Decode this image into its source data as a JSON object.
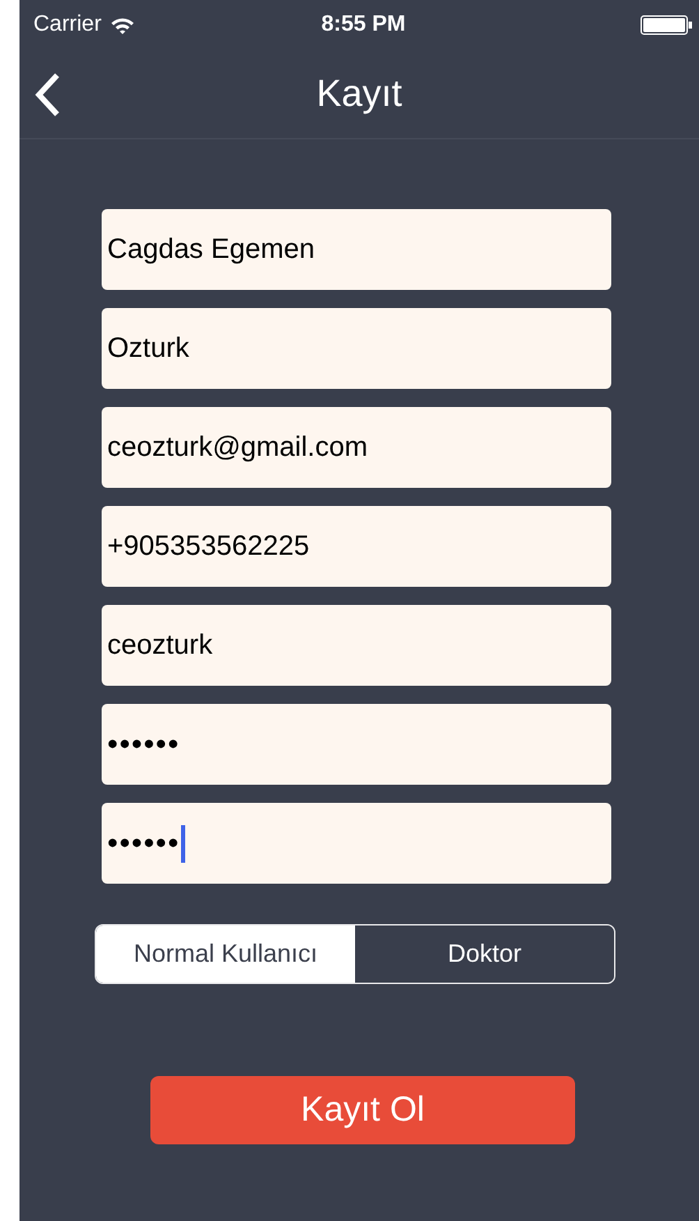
{
  "status_bar": {
    "carrier": "Carrier",
    "time": "8:55 PM"
  },
  "nav": {
    "title": "Kayıt"
  },
  "fields": [
    {
      "kind": "text",
      "value": "Cagdas Egemen",
      "focused": false
    },
    {
      "kind": "text",
      "value": "Ozturk",
      "focused": false
    },
    {
      "kind": "text",
      "value": "ceozturk@gmail.com",
      "focused": false
    },
    {
      "kind": "text",
      "value": "+905353562225",
      "focused": false
    },
    {
      "kind": "text",
      "value": "ceozturk",
      "focused": false
    },
    {
      "kind": "password",
      "value": "••••••",
      "focused": false
    },
    {
      "kind": "password",
      "value": "••••••",
      "focused": true
    }
  ],
  "segments": [
    {
      "label": "Normal Kullanıcı",
      "selected": true
    },
    {
      "label": "Doktor",
      "selected": false
    }
  ],
  "submit": {
    "label": "Kayıt Ol"
  }
}
